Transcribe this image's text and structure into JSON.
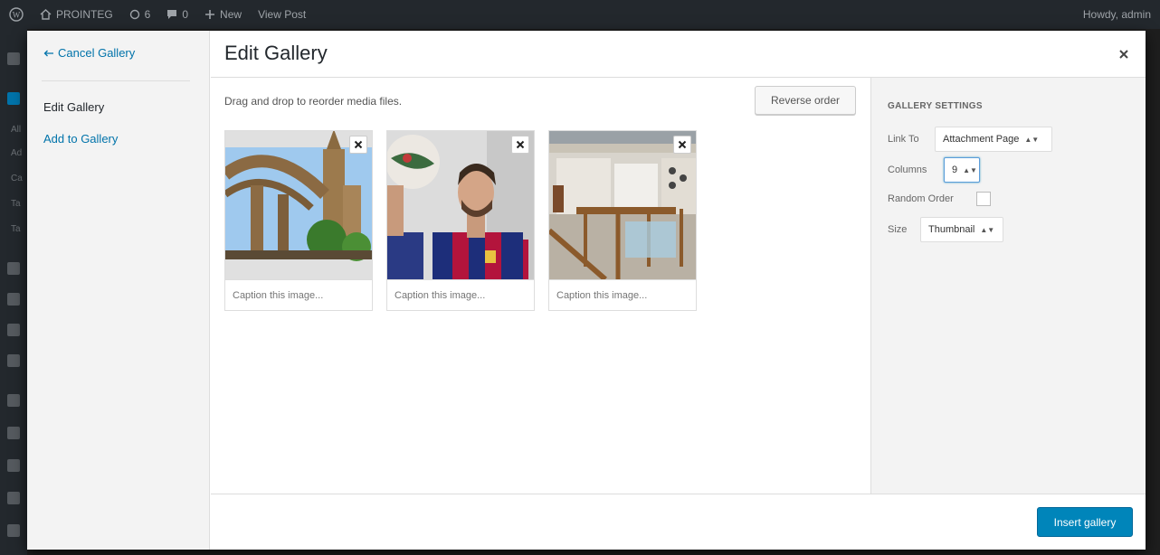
{
  "admin_bar": {
    "site_name": "PROINTEG",
    "updates_count": "6",
    "comments_count": "0",
    "new_label": "New",
    "view_post_label": "View Post",
    "howdy_label": "Howdy, admin"
  },
  "admin_menu": {
    "items": [
      "All",
      "Ad",
      "Ca",
      "Ta",
      "Ta"
    ]
  },
  "menu": {
    "cancel_label": "Cancel Gallery",
    "current_label": "Edit Gallery",
    "add_label": "Add to Gallery"
  },
  "title": "Edit Gallery",
  "content": {
    "instructions": "Drag and drop to reorder media files.",
    "reverse_label": "Reverse order",
    "attachments": [
      {
        "image": "bridge-cathedral",
        "caption_placeholder": "Caption this image..."
      },
      {
        "image": "footballer",
        "caption_placeholder": "Caption this image..."
      },
      {
        "image": "interior-staircase",
        "caption_placeholder": "Caption this image..."
      }
    ]
  },
  "settings": {
    "heading": "GALLERY SETTINGS",
    "link_to_label": "Link To",
    "link_to_value": "Attachment Page",
    "columns_label": "Columns",
    "columns_value": "9",
    "random_label": "Random Order",
    "random_checked": false,
    "size_label": "Size",
    "size_value": "Thumbnail"
  },
  "toolbar": {
    "insert_label": "Insert gallery"
  },
  "colors": {
    "accent": "#0073aa",
    "primary_button": "#0085ba",
    "admin_bar": "#23282d"
  }
}
